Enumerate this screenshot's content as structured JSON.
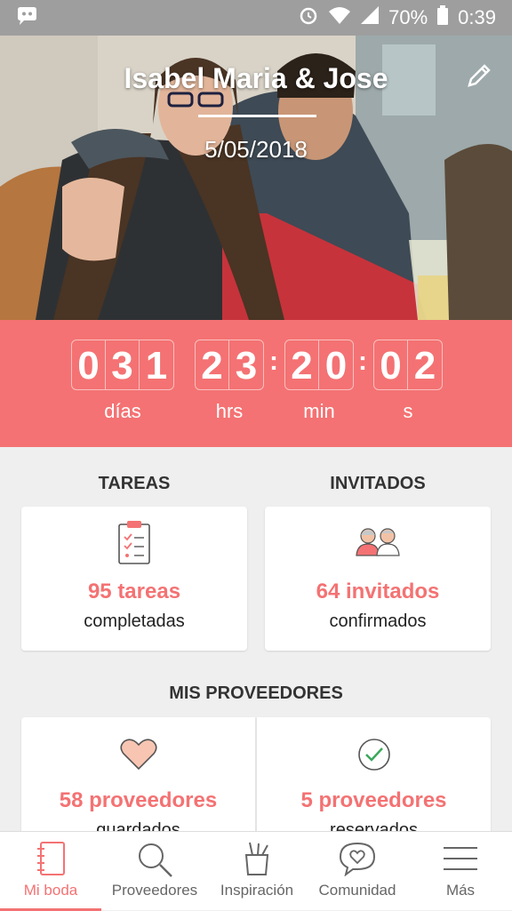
{
  "status_bar": {
    "battery_percent": "70%",
    "time": "0:39"
  },
  "hero": {
    "title": "Isabel Maria & Jose",
    "date": "5/05/2018"
  },
  "countdown": {
    "days": [
      "0",
      "3",
      "1"
    ],
    "hours": [
      "2",
      "3"
    ],
    "minutes": [
      "2",
      "0"
    ],
    "seconds": [
      "0",
      "2"
    ],
    "labels": {
      "days": "días",
      "hours": "hrs",
      "minutes": "min",
      "seconds": "s"
    }
  },
  "sections": {
    "tasks_title": "TAREAS",
    "guests_title": "INVITADOS",
    "providers_title": "MIS PROVEEDORES"
  },
  "cards": {
    "tasks": {
      "count": "95 tareas",
      "label": "completadas"
    },
    "guests": {
      "count": "64 invitados",
      "label": "confirmados"
    },
    "providers_saved": {
      "count": "58 proveedores",
      "label": "guardados"
    },
    "providers_booked": {
      "count": "5 proveedores",
      "label": "reservados"
    }
  },
  "nav": {
    "items": [
      {
        "label": "Mi boda"
      },
      {
        "label": "Proveedores"
      },
      {
        "label": "Inspiración"
      },
      {
        "label": "Comunidad"
      },
      {
        "label": "Más"
      }
    ]
  },
  "colors": {
    "accent": "#f47273",
    "status_bar": "#9e9e9e"
  }
}
